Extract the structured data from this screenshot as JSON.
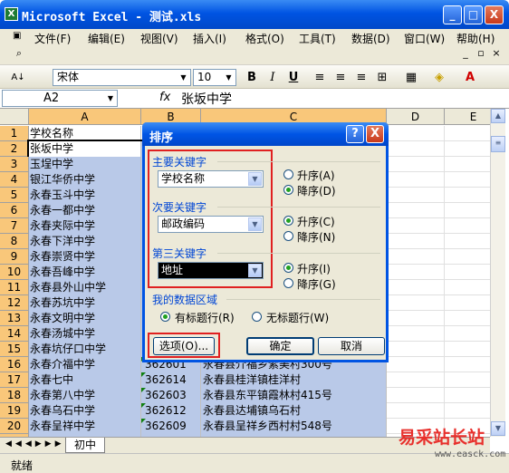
{
  "window": {
    "title": "Microsoft Excel - 测试.xls",
    "min": "_",
    "max": "□",
    "close": "X"
  },
  "menu": {
    "items": [
      "文件(F)",
      "编辑(E)",
      "视图(V)",
      "插入(I)",
      "格式(O)",
      "工具(T)",
      "数据(D)",
      "窗口(W)",
      "帮助(H)"
    ]
  },
  "toolbar": {
    "font": "宋体",
    "size": "10",
    "bold": "B",
    "italic": "I",
    "underline": "U"
  },
  "formula": {
    "namebox": "A2",
    "fx": "fx",
    "value": "张坂中学"
  },
  "columns": [
    "A",
    "B",
    "C",
    "D",
    "E"
  ],
  "rows": [
    {
      "n": "1",
      "a": "学校名称",
      "b": "",
      "c": ""
    },
    {
      "n": "2",
      "a": "张坂中学",
      "b": "",
      "c": ""
    },
    {
      "n": "3",
      "a": "玉埕中学",
      "b": "",
      "c": ""
    },
    {
      "n": "4",
      "a": "银江华侨中学",
      "b": "",
      "c": ""
    },
    {
      "n": "5",
      "a": "永春玉斗中学",
      "b": "",
      "c": ""
    },
    {
      "n": "6",
      "a": "永春一都中学",
      "b": "",
      "c": ""
    },
    {
      "n": "7",
      "a": "永春夹际中学",
      "b": "",
      "c": ""
    },
    {
      "n": "8",
      "a": "永春下洋中学",
      "b": "",
      "c": ""
    },
    {
      "n": "9",
      "a": "永春崇贤中学",
      "b": "",
      "c": ""
    },
    {
      "n": "10",
      "a": "永春吾峰中学",
      "b": "",
      "c": ""
    },
    {
      "n": "11",
      "a": "永春县外山中学",
      "b": "",
      "c": ""
    },
    {
      "n": "12",
      "a": "永春苏坑中学",
      "b": "",
      "c": ""
    },
    {
      "n": "13",
      "a": "永春文明中学",
      "b": "",
      "c": ""
    },
    {
      "n": "14",
      "a": "永春汤城中学",
      "b": "",
      "c": ""
    },
    {
      "n": "15",
      "a": "永春坑仔口中学",
      "b": "",
      "c": ""
    },
    {
      "n": "16",
      "a": "永春介福中学",
      "b": "362601",
      "c": "永春县介福乡紫美村300号"
    },
    {
      "n": "17",
      "a": "永春七中",
      "b": "362614",
      "c": "永春县桂洋镇桂洋村"
    },
    {
      "n": "18",
      "a": "永春第八中学",
      "b": "362603",
      "c": "永春县东平镇霞林村415号"
    },
    {
      "n": "19",
      "a": "永春乌石中学",
      "b": "362612",
      "c": "永春县达埔镇乌石村"
    },
    {
      "n": "20",
      "a": "永春呈祥中学",
      "b": "362609",
      "c": "永春县呈祥乡西村村548号"
    },
    {
      "n": "21",
      "a": "",
      "b": "",
      "c": ""
    }
  ],
  "sheet": {
    "tab": "初中"
  },
  "status": {
    "text": "就绪"
  },
  "dialog": {
    "title": "排序",
    "help": "?",
    "close": "X",
    "key1": {
      "label": "主要关键字",
      "value": "学校名称",
      "asc": "升序(A)",
      "desc": "降序(D)"
    },
    "key2": {
      "label": "次要关键字",
      "value": "邮政编码",
      "asc": "升序(C)",
      "desc": "降序(N)"
    },
    "key3": {
      "label": "第三关键字",
      "value": "地址",
      "asc": "升序(I)",
      "desc": "降序(G)"
    },
    "range": {
      "label": "我的数据区域",
      "header": "有标题行(R)",
      "noheader": "无标题行(W)"
    },
    "options": "选项(O)...",
    "ok": "确定",
    "cancel": "取消"
  },
  "watermark": {
    "text": "易采站长站",
    "url": "www.easck.com"
  }
}
